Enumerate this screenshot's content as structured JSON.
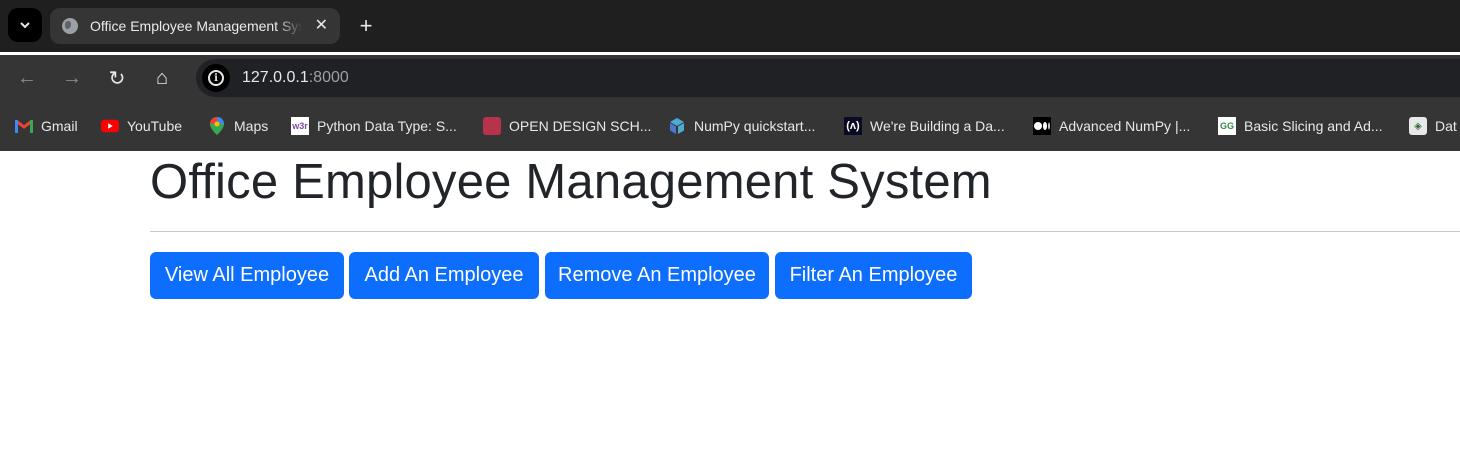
{
  "browser": {
    "tab_title": "Office Employee Management System",
    "tab_close_glyph": "✕",
    "new_tab_glyph": "+",
    "nav": {
      "back": "←",
      "forward": "→",
      "reload": "↻",
      "home": "⌂"
    },
    "url_host": "127.0.0.1",
    "url_port": ":8000",
    "bookmarks": [
      {
        "label": "Gmail",
        "icon": "gmail-icon"
      },
      {
        "label": "YouTube",
        "icon": "youtube-icon"
      },
      {
        "label": "Maps",
        "icon": "maps-icon"
      },
      {
        "label": "Python Data Type: S...",
        "icon": "w3schools-icon"
      },
      {
        "label": "OPEN DESIGN SCH...",
        "icon": "open-design-icon"
      },
      {
        "label": "NumPy quickstart...",
        "icon": "numpy-icon"
      },
      {
        "label": "We're Building a Da...",
        "icon": "freecodecamp-icon"
      },
      {
        "label": "Advanced NumPy |...",
        "icon": "medium-icon"
      },
      {
        "label": "Basic Slicing and Ad...",
        "icon": "geeksforgeeks-icon"
      },
      {
        "label": "Dat",
        "icon": "data-icon"
      }
    ]
  },
  "page": {
    "title": "Office Employee Management System",
    "buttons": [
      {
        "label": "View All Employee"
      },
      {
        "label": "Add An Employee"
      },
      {
        "label": "Remove An Employee"
      },
      {
        "label": "Filter An Employee"
      }
    ]
  },
  "colors": {
    "primary": "#0d6efd",
    "heading": "#212529",
    "chrome_dark": "#1f1f1f",
    "chrome_toolbar": "#353535"
  }
}
